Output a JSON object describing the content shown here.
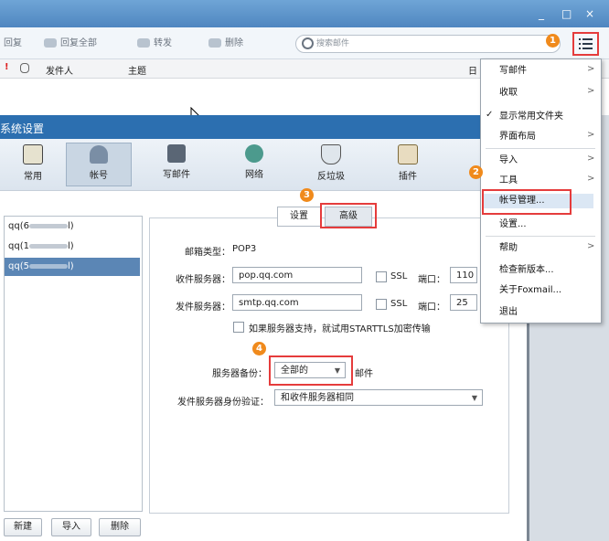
{
  "window": {
    "controls": [
      "_",
      "□",
      "×"
    ]
  },
  "toolbar": {
    "reply": "回复",
    "reply_all": "回复全部",
    "forward": "转发",
    "delete": "删除",
    "search_placeholder": "搜索邮件"
  },
  "list_header": {
    "from": "发件人",
    "subject": "主题",
    "date": "日"
  },
  "settings": {
    "title": "系统设置",
    "nav": [
      {
        "label": "常用"
      },
      {
        "label": "帐号"
      },
      {
        "label": "写邮件"
      },
      {
        "label": "网络"
      },
      {
        "label": "反垃圾"
      },
      {
        "label": "插件"
      }
    ],
    "accounts": [
      "qq(6",
      "qq(1",
      "qq(5"
    ],
    "account_suffix": "l)",
    "buttons": {
      "new": "新建",
      "import": "导入",
      "delete": "删除"
    },
    "tabs": {
      "settings": "设置",
      "advanced": "高级"
    },
    "form": {
      "mailbox_type_label": "邮箱类型：",
      "mailbox_type_value": "POP3",
      "incoming_label": "收件服务器：",
      "incoming_value": "pop.qq.com",
      "outgoing_label": "发件服务器：",
      "outgoing_value": "smtp.qq.com",
      "ssl": "SSL",
      "port_label": "端口：",
      "incoming_port": "110",
      "outgoing_port": "25",
      "starttls": "如果服务器支持，就试用STARTTLS加密传输",
      "backup_label": "服务器备份：",
      "backup_value": "全部的",
      "backup_suffix": "邮件",
      "auth_label": "发件服务器身份验证：",
      "auth_value": "和收件服务器相同"
    }
  },
  "menu": {
    "items": [
      {
        "label": "写邮件",
        "submenu": true
      },
      {
        "label": "收取",
        "submenu": true
      },
      {
        "label": "显示常用文件夹",
        "checked": true
      },
      {
        "label": "界面布局",
        "submenu": true
      },
      {
        "label": "导入",
        "submenu": true
      },
      {
        "label": "工具",
        "submenu": true
      },
      {
        "label": "帐号管理..."
      },
      {
        "label": "设置..."
      },
      {
        "label": "帮助",
        "submenu": true
      },
      {
        "label": "检查新版本..."
      },
      {
        "label": "关于Foxmail..."
      },
      {
        "label": "退出"
      }
    ]
  },
  "badges": [
    "1",
    "2",
    "3",
    "4"
  ],
  "colors": {
    "titlebar": "#4f86c0",
    "settings_header": "#2c6fb0",
    "highlight": "#e53c3c",
    "badge": "#f08a1c",
    "selected_account": "#5b86b5"
  },
  "icons": [
    "menu-icon",
    "search-icon",
    "reply-icon",
    "reply-all-icon",
    "forward-icon",
    "delete-icon",
    "flag-icon",
    "attachment-icon",
    "mouse-cursor-icon"
  ]
}
